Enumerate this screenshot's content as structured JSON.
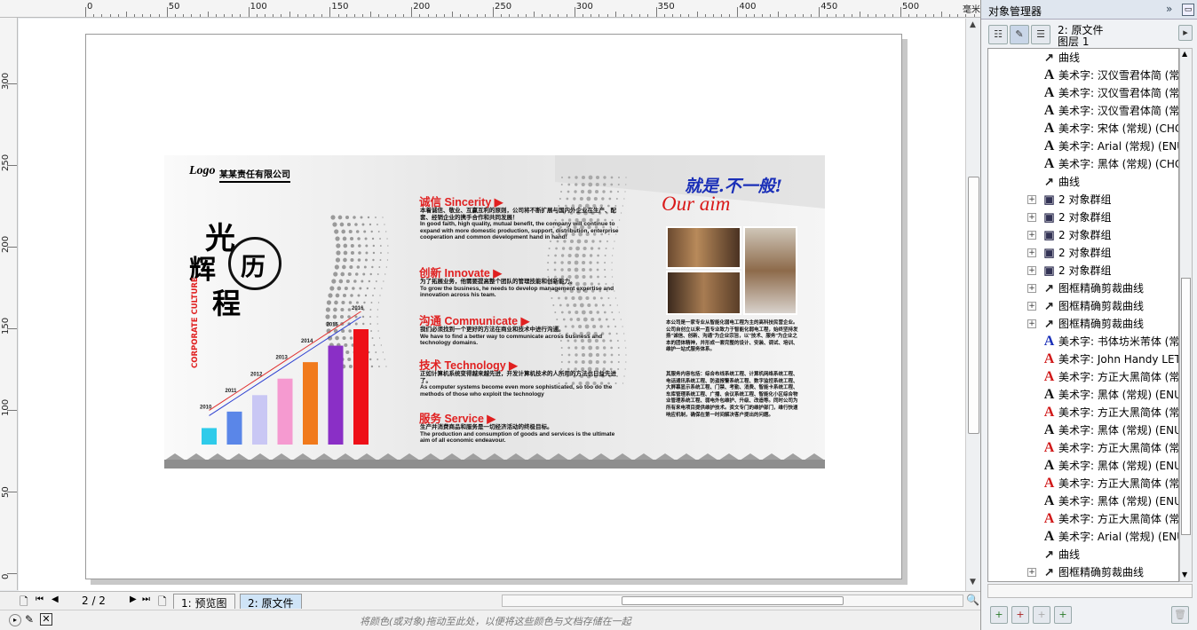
{
  "ruler": {
    "unit": "毫米",
    "top_labels": [
      "0",
      "50",
      "100",
      "150",
      "200",
      "250",
      "300",
      "350",
      "400",
      "450",
      "500"
    ],
    "left_labels": [
      "300",
      "250",
      "200",
      "150",
      "100",
      "50",
      "0"
    ]
  },
  "design": {
    "logo_script": "Logo",
    "company": "某某责任有限公司",
    "vertical_title": [
      "光",
      "辉",
      "历",
      "程"
    ],
    "vertical_sub": "CORPORATE CULTURE",
    "years": [
      "2010",
      "2011",
      "2012",
      "2013",
      "2014",
      "2015",
      "2016"
    ],
    "bar_values": [
      1,
      2,
      3,
      4,
      5,
      6,
      7
    ],
    "bar_colors": [
      "#2ecbea",
      "#5a86e8",
      "#c9c7f4",
      "#f59ad0",
      "#f17a1c",
      "#8a2fc6",
      "#ee1018"
    ],
    "sections": [
      {
        "title": "诚信 Sincerity ▶",
        "body": [
          "本着诚信、敬业、互赢互利的原则，公司将不断扩展与国内外企业在生产、配套、经销企业的携手合作和共同发展！",
          "In good faith, high quality, mutual benefit, the company will continue to expand with more domestic production, support, distribution, enterprise cooperation and common development hand in hand!"
        ]
      },
      {
        "title": "创新 Innovate ▶",
        "body": [
          "为了拓展业务，他需要提高整个团队的管理技能和创新能力。",
          "To grow the business, he needs to develop management expertise and innovation across his team."
        ]
      },
      {
        "title": "沟通 Communicate ▶",
        "body": [
          "我们必须找到一个更好的方法在商业和技术中进行沟通。",
          "We have to find a better way to communicate across business and technology domains."
        ]
      },
      {
        "title": "技术 Technology ▶",
        "body": [
          "正如计算机系统变得越来越先进，开发计算机技术的人所用的方法也日益先进了。",
          "As computer systems become even more sophisticated, so too do the methods of those who exploit the technology"
        ]
      },
      {
        "title": "服务 Service ▶",
        "body": [
          "生产并消费商品和服务是一切经济活动的终极目标。",
          "The production and consumption of goods and services is the ultimate aim of all economic endeavour."
        ]
      }
    ],
    "slogan_cn": "就是.不一般!",
    "slogan_en": "Our aim",
    "about_p1": "本公司是一家专业从智能化弱电工程为主的高科技民营企业。公司自创立以来一直专业致力于智能化弱电工程，始终坚持发扬\"诚信、创新、沟通\"为企业宗旨，以\"技术、服务\"为企业之本的团体精神，并形成一套完整的设计、安装、调试、培训、维护一站式服务体系。",
    "about_p2": "其服务内容包括：综合布线系统工程、计算机网络系统工程、电话通讯系统工程、防盗报警系统工程、数字监控系统工程、大屏幕显示系统工程、门禁、考勤、消费、智能卡系统工程、车库管理系统工程、广播、会议系统工程、智能化小区综合物业管理系统工程、弱电外包维护、升级、改造等。同时公司为所有来电项目提供维护技术。资文专门的维护部门，维行快速响应机制，确保在第一时间解决客户提出的问题。"
  },
  "bottombar": {
    "page_indicator": "2 / 2",
    "tab_preview": "1: 预览图",
    "tab_source": "2: 原文件"
  },
  "status": {
    "hint": "将颜色(或对象)拖动至此处，以便将这些颜色与文档存储在一起"
  },
  "panel": {
    "title": "对象管理器",
    "doc_name": "2: 原文件",
    "layer": "图层 1",
    "items": [
      {
        "type": "curve",
        "label": "曲线",
        "indent": 1,
        "expand": false
      },
      {
        "type": "text",
        "color": "black",
        "label": "美术字: 汉仪雪君体简 (常",
        "indent": 1,
        "expand": false
      },
      {
        "type": "text",
        "color": "black",
        "label": "美术字: 汉仪雪君体简 (常",
        "indent": 1,
        "expand": false
      },
      {
        "type": "text",
        "color": "black",
        "label": "美术字: 汉仪雪君体简 (常",
        "indent": 1,
        "expand": false
      },
      {
        "type": "text",
        "color": "black",
        "label": "美术字: 宋体 (常规) (CHC",
        "indent": 1,
        "expand": false
      },
      {
        "type": "text",
        "color": "black",
        "label": "美术字: Arial (常规) (ENU",
        "indent": 1,
        "expand": false
      },
      {
        "type": "text",
        "color": "black",
        "label": "美术字: 黑体 (常规) (CHC",
        "indent": 1,
        "expand": false
      },
      {
        "type": "curve",
        "label": "曲线",
        "indent": 1,
        "expand": false
      },
      {
        "type": "group",
        "label": "2 对象群组",
        "indent": 0,
        "expand": true
      },
      {
        "type": "group",
        "label": "2 对象群组",
        "indent": 0,
        "expand": true
      },
      {
        "type": "group",
        "label": "2 对象群组",
        "indent": 0,
        "expand": true
      },
      {
        "type": "group",
        "label": "2 对象群组",
        "indent": 0,
        "expand": true
      },
      {
        "type": "group",
        "label": "2 对象群组",
        "indent": 0,
        "expand": true
      },
      {
        "type": "curve",
        "label": "图框精确剪裁曲线",
        "indent": 0,
        "expand": true
      },
      {
        "type": "curve",
        "label": "图框精确剪裁曲线",
        "indent": 0,
        "expand": true
      },
      {
        "type": "curve",
        "label": "图框精确剪裁曲线",
        "indent": 0,
        "expand": true
      },
      {
        "type": "text",
        "color": "blue",
        "label": "美术字: 书体坊米芾体 (常",
        "indent": 1,
        "expand": false
      },
      {
        "type": "text",
        "color": "red",
        "label": "美术字: John Handy LET",
        "indent": 1,
        "expand": false
      },
      {
        "type": "text",
        "color": "red",
        "label": "美术字: 方正大黑简体 (常",
        "indent": 1,
        "expand": false
      },
      {
        "type": "text",
        "color": "black",
        "label": "美术字: 黑体 (常规) (ENU",
        "indent": 1,
        "expand": false
      },
      {
        "type": "text",
        "color": "red",
        "label": "美术字: 方正大黑简体 (常",
        "indent": 1,
        "expand": false
      },
      {
        "type": "text",
        "color": "black",
        "label": "美术字: 黑体 (常规) (ENU",
        "indent": 1,
        "expand": false
      },
      {
        "type": "text",
        "color": "red",
        "label": "美术字: 方正大黑简体 (常",
        "indent": 1,
        "expand": false
      },
      {
        "type": "text",
        "color": "black",
        "label": "美术字: 黑体 (常规) (ENU",
        "indent": 1,
        "expand": false
      },
      {
        "type": "text",
        "color": "red",
        "label": "美术字: 方正大黑简体 (常",
        "indent": 1,
        "expand": false
      },
      {
        "type": "text",
        "color": "black",
        "label": "美术字: 黑体 (常规) (ENU",
        "indent": 1,
        "expand": false
      },
      {
        "type": "text",
        "color": "red",
        "label": "美术字: 方正大黑简体 (常",
        "indent": 1,
        "expand": false
      },
      {
        "type": "text",
        "color": "black",
        "label": "美术字: Arial (常规) (ENU",
        "indent": 1,
        "expand": false
      },
      {
        "type": "curve",
        "label": "曲线",
        "indent": 1,
        "expand": false
      },
      {
        "type": "curve",
        "label": "图框精确剪裁曲线",
        "indent": 0,
        "expand": true
      }
    ]
  }
}
